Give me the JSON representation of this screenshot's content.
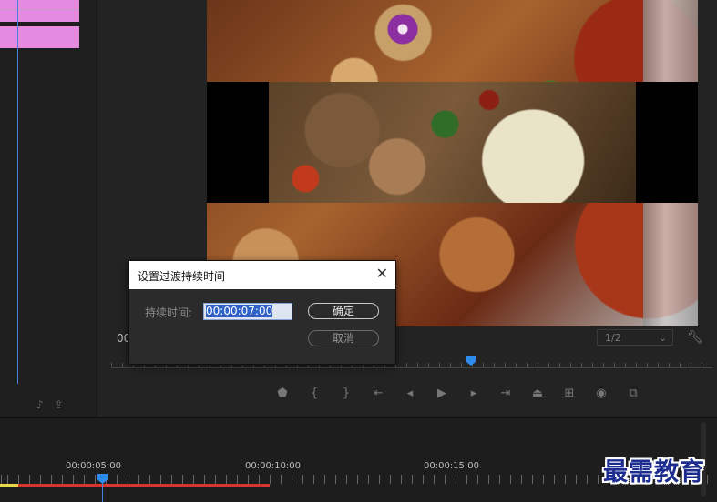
{
  "dialog": {
    "title": "设置过渡持续时间",
    "duration_label": "持续时间:",
    "duration_value": "00:00:07:00",
    "ok_label": "确定",
    "cancel_label": "取消",
    "close_icon": "close-icon"
  },
  "program_monitor": {
    "timecode": "00",
    "fraction": "1/2",
    "settings_icon": "wrench-icon"
  },
  "transport": {
    "icons": [
      "add-marker-icon",
      "mark-in-icon",
      "mark-out-icon",
      "go-to-in-icon",
      "step-back-icon",
      "play-icon",
      "step-forward-icon",
      "go-to-out-icon",
      "lift-icon",
      "extract-icon",
      "export-frame-icon",
      "button-editor-icon"
    ]
  },
  "timeline": {
    "labels": [
      "00:00:05:00",
      "00:00:10:00",
      "00:00:15:00"
    ]
  },
  "watermark": "最需教育",
  "colors": {
    "clip": "#e48ae0",
    "playhead": "#2d8ceb",
    "work_area": "#d8352c",
    "watermark": "#1d2d8f"
  }
}
